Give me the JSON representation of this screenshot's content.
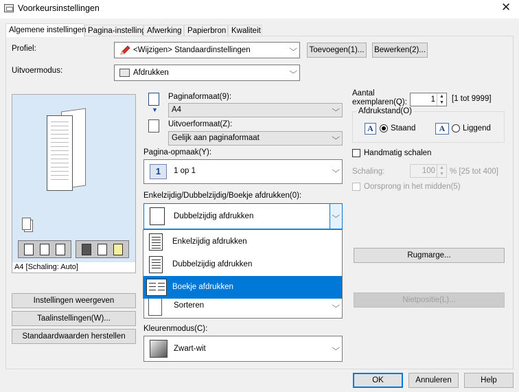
{
  "window": {
    "title": "Voorkeursinstellingen",
    "close_glyph": "✕"
  },
  "tabs": [
    "Algemene instellingen",
    "Pagina-instelling",
    "Afwerking",
    "Papierbron",
    "Kwaliteit"
  ],
  "profile": {
    "label": "Profiel:",
    "value": "<Wijzigen> Standaardinstellingen",
    "add_button": "Toevoegen(1)...",
    "edit_button": "Bewerken(2)..."
  },
  "output_mode": {
    "label": "Uitvoermodus:",
    "value": "Afdrukken"
  },
  "preview": {
    "caption": "A4 [Schaling: Auto]"
  },
  "left_buttons": {
    "show_settings": "Instellingen weergeven",
    "language": "Taalinstellingen(W)...",
    "restore": "Standaardwaarden herstellen"
  },
  "page_size": {
    "label": "Paginaformaat(9):",
    "value": "A4"
  },
  "output_size": {
    "label": "Uitvoerformaat(Z):",
    "value": "Gelijk aan paginaformaat"
  },
  "page_layout": {
    "label": "Pagina-opmaak(Y):",
    "value": "1 op 1",
    "icon_text": "1"
  },
  "duplex": {
    "label": "Enkelzijdig/Dubbelzijdig/Boekje afdrukken(0):",
    "value": "Dubbelzijdig afdrukken",
    "options": [
      "Enkelzijdig afdrukken",
      "Dubbelzijdig afdrukken",
      "Boekje afdrukken"
    ],
    "highlighted": "Boekje afdrukken"
  },
  "collate": {
    "value": "Sorteren"
  },
  "color_mode": {
    "label": "Kleurenmodus(C):",
    "value": "Zwart-wit"
  },
  "copies": {
    "label_line1": "Aantal",
    "label_line2": "exemplaren(Q):",
    "value": "1",
    "range": "[1 tot 9999]"
  },
  "orientation": {
    "group_label": "Afdrukstand(O)",
    "portrait": "Staand",
    "landscape": "Liggend",
    "selected": "Staand",
    "icon_letter": "A"
  },
  "manual_scaling": {
    "label": "Handmatig schalen",
    "checked": false
  },
  "scaling": {
    "label": "Schaling:",
    "value": "100",
    "range": "% [25 tot 400]"
  },
  "center_origin": {
    "label": "Oorsprong in het midden(5)",
    "checked": false
  },
  "binding_margin_button": "Rugmarge...",
  "staple_position_button": "Nietpositie(L)...",
  "footer": {
    "ok": "OK",
    "cancel": "Annuleren",
    "help": "Help"
  },
  "colors": {
    "accent": "#0078d7",
    "preview_bg": "#d9e8f7",
    "window_bg": "#f0f0f0"
  }
}
